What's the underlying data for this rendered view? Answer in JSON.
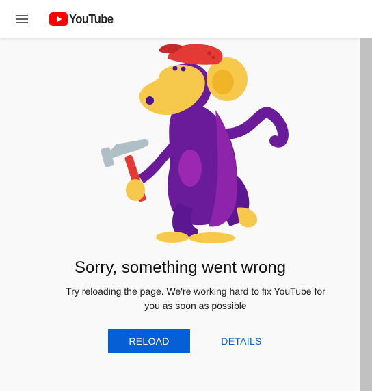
{
  "header": {
    "menu_icon": "hamburger-menu-icon",
    "logo_icon": "youtube-play-logo-icon",
    "logo_text": "YouTube"
  },
  "illustration": {
    "icon": "monkey-with-hammer-illustration"
  },
  "error": {
    "title": "Sorry, something went wrong",
    "message": "Try reloading the page. We're working hard to fix YouTube for you as soon as possible"
  },
  "actions": {
    "reload_label": "RELOAD",
    "details_label": "DETAILS"
  },
  "colors": {
    "brand_red": "#ff0000",
    "accent_blue": "#065fd4",
    "background": "#f9f9f9",
    "monkey_purple": "#6a1b9a",
    "monkey_face": "#f6c94d",
    "hat_red": "#e53935"
  }
}
